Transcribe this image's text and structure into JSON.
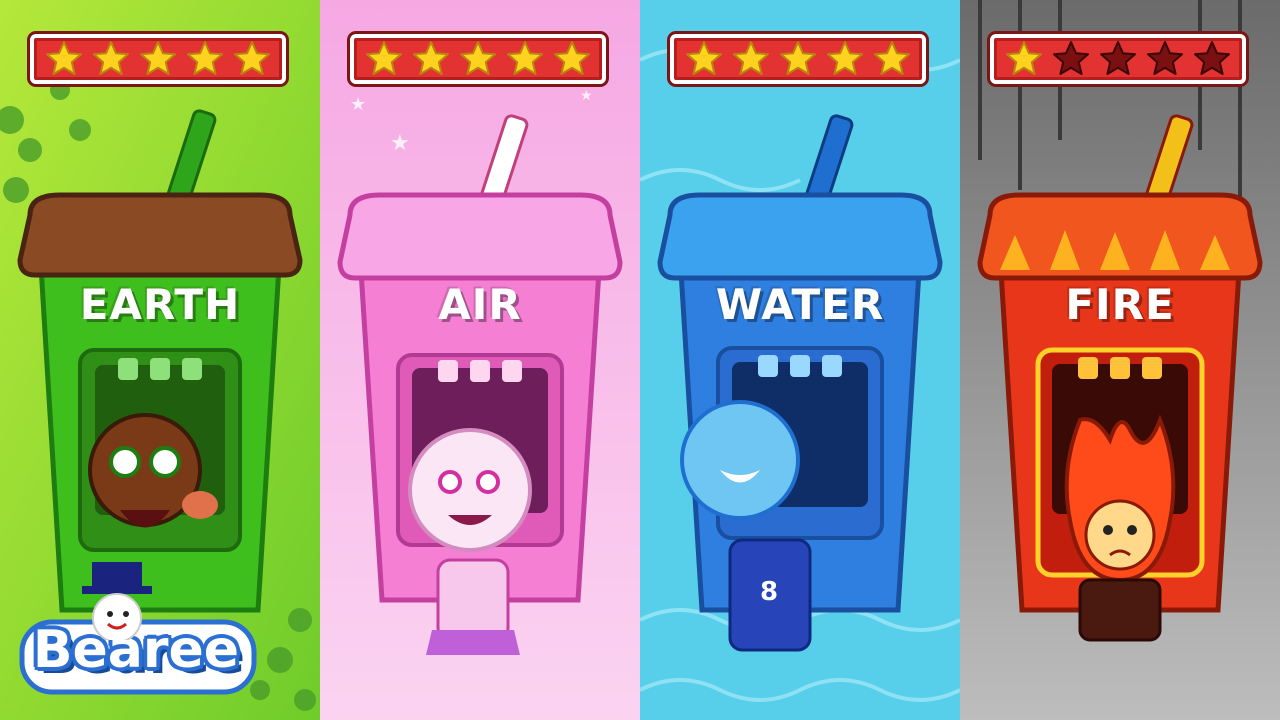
{
  "panels": [
    {
      "label": "EARTH",
      "stars_filled": 5,
      "stars_total": 5,
      "theme": "earth",
      "colors": {
        "bg": "#8fd63a",
        "cup": "#3fbf1e",
        "lid": "#8a4a24",
        "straw": "#2fa51c"
      }
    },
    {
      "label": "AIR",
      "stars_filled": 5,
      "stars_total": 5,
      "theme": "air",
      "colors": {
        "bg": "#f7b2e6",
        "cup": "#f47fd3",
        "lid": "#f9a6e6",
        "straw": "#e0598c"
      }
    },
    {
      "label": "WATER",
      "stars_filled": 5,
      "stars_total": 5,
      "theme": "water",
      "colors": {
        "bg": "#4fcbe8",
        "cup": "#2f7fe0",
        "lid": "#3aa2ee",
        "straw": "#1f6fd1"
      }
    },
    {
      "label": "FIRE",
      "stars_filled": 1,
      "stars_total": 5,
      "theme": "fire",
      "colors": {
        "bg": "#8c8c8c",
        "cup": "#e8361b",
        "lid": "#f0561d",
        "straw": "#e0301a"
      }
    }
  ],
  "brand": {
    "name": "Bearee"
  },
  "colors": {
    "star_filled": "#ffd21f",
    "star_empty": "#7a1010",
    "rating_bg": "#e23232"
  }
}
